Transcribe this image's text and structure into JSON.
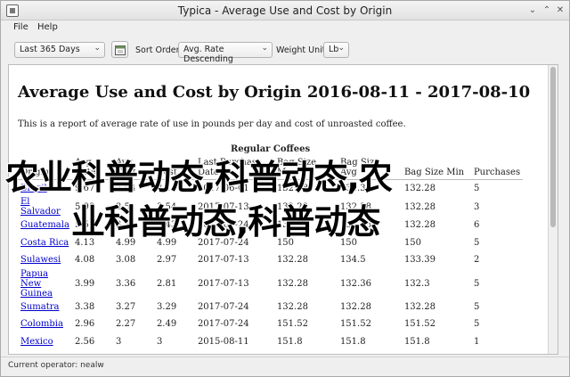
{
  "window": {
    "title": "Typica - Average Use and Cost by Origin"
  },
  "menu": {
    "file": "File",
    "help": "Help"
  },
  "toolbar": {
    "range_value": "Last 365 Days",
    "sort_label": "Sort Order:",
    "sort_value": "Avg. Rate Descending",
    "weight_label": "Weight Unit:",
    "weight_value": "Lb"
  },
  "report": {
    "title": "Average Use and Cost by Origin 2016-08-11 - 2017-08-10",
    "description": "This is a report of average rate of use in pounds per day and cost of unroasted coffee.",
    "table_caption": "Regular Coffees",
    "columns": [
      "Origin",
      "Avg Rate",
      "Avg Cost",
      "Cost",
      "Last Purchase Date",
      "Bag Size Max",
      "Bag Size Avg",
      "Bag Size Min",
      "Purchases"
    ],
    "rows": [
      {
        "origin": "Brazil",
        "c1": "9.67",
        "c2": "2.64",
        "c3": "3.1",
        "c4": "2017-06-01",
        "c5": "132.28",
        "c6": "132.3",
        "c7": "132.28",
        "c8": "5"
      },
      {
        "origin": "El Salvador",
        "c1": "5.98",
        "c2": "3.5",
        "c3": "3.54",
        "c4": "2017-07-13",
        "c5": "132.28",
        "c6": "132.28",
        "c7": "132.28",
        "c8": "3"
      },
      {
        "origin": "Guatemala",
        "c1": "5.5",
        "c2": "3.24",
        "c3": "3.43",
        "c4": "2017-07-24",
        "c5": "133.1",
        "c6": "132.28",
        "c7": "132.28",
        "c8": "6"
      },
      {
        "origin": "Costa Rica",
        "c1": "4.13",
        "c2": "4.99",
        "c3": "4.99",
        "c4": "2017-07-24",
        "c5": "150",
        "c6": "150",
        "c7": "150",
        "c8": "5"
      },
      {
        "origin": "Sulawesi",
        "c1": "4.08",
        "c2": "3.08",
        "c3": "2.97",
        "c4": "2017-07-13",
        "c5": "132.28",
        "c6": "134.5",
        "c7": "133.39",
        "c8": "2"
      },
      {
        "origin": "Papua New Guinea",
        "c1": "3.99",
        "c2": "3.36",
        "c3": "2.81",
        "c4": "2017-07-13",
        "c5": "132.28",
        "c6": "132.36",
        "c7": "132.3",
        "c8": "5"
      },
      {
        "origin": "Sumatra",
        "c1": "3.38",
        "c2": "3.27",
        "c3": "3.29",
        "c4": "2017-07-24",
        "c5": "132.28",
        "c6": "132.28",
        "c7": "132.28",
        "c8": "5"
      },
      {
        "origin": "Colombia",
        "c1": "2.96",
        "c2": "2.27",
        "c3": "2.49",
        "c4": "2017-07-24",
        "c5": "151.52",
        "c6": "151.52",
        "c7": "151.52",
        "c8": "5"
      },
      {
        "origin": "Mexico",
        "c1": "2.56",
        "c2": "3",
        "c3": "3",
        "c4": "2015-08-11",
        "c5": "151.8",
        "c6": "151.8",
        "c7": "151.8",
        "c8": "1"
      }
    ]
  },
  "overlay": {
    "line1": "农业科普动态,科普动态,农",
    "line2": "业科普动态,科普动态"
  },
  "status": {
    "text": "Current operator: nealw"
  }
}
